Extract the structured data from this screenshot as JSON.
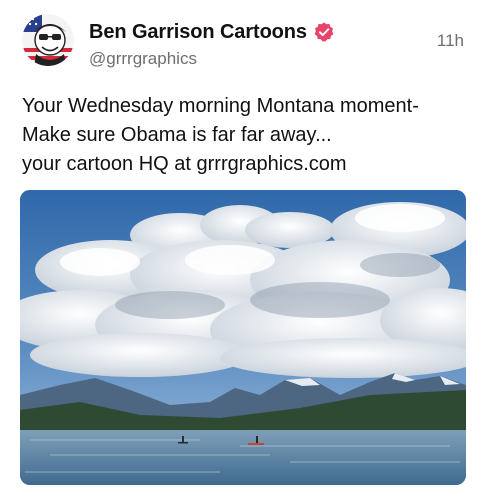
{
  "post": {
    "author": {
      "name": "Ben Garrison Cartoons",
      "handle": "@grrrgraphics",
      "verified": true
    },
    "timestamp": "11h",
    "text_lines": [
      "Your Wednesday morning Montana moment-",
      "Make sure Obama is far far away...",
      "your cartoon HQ at grrrgraphics.com"
    ],
    "media": {
      "kind": "photo",
      "subject": "mountain-lake-with-clouds"
    }
  },
  "colors": {
    "text_primary": "#111111",
    "text_secondary": "#6e6e73",
    "verified_badge": "#e8436a",
    "background": "#ffffff"
  }
}
